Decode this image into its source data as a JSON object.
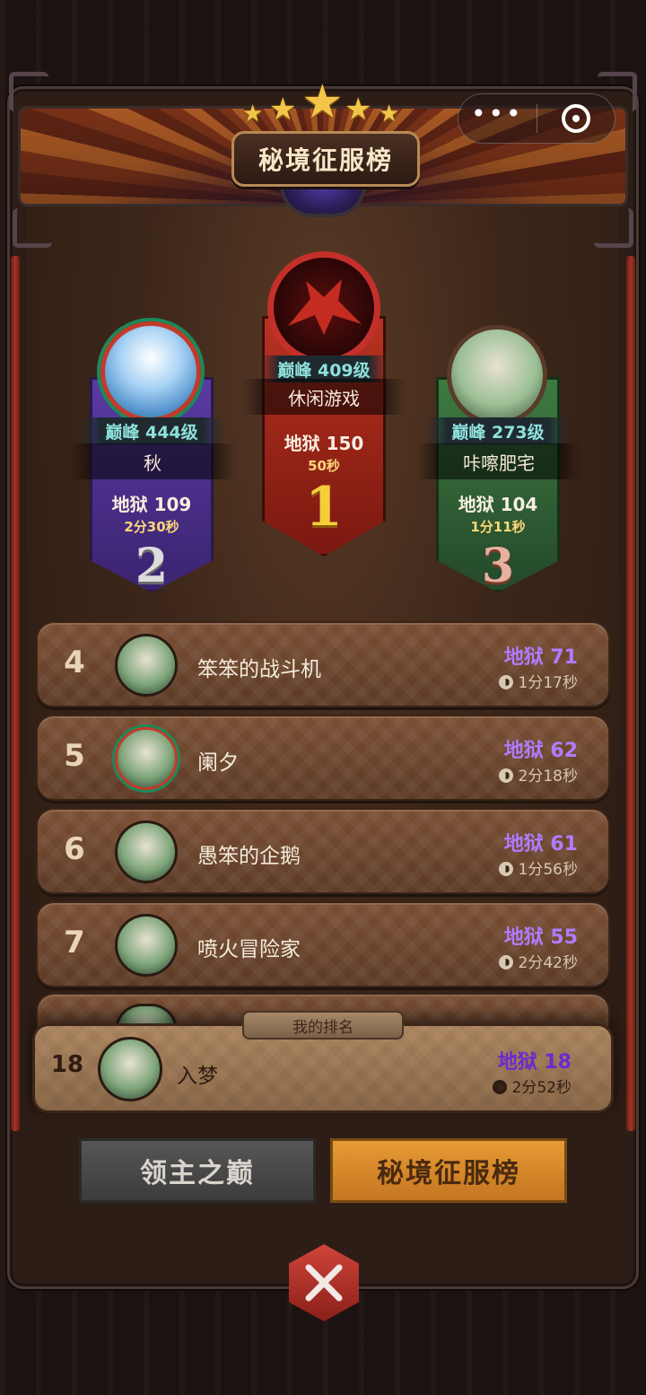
{
  "page": {
    "title": "秘境征服榜"
  },
  "capsule": {
    "more_icon": "ellipsis-icon",
    "close_icon": "target-icon"
  },
  "podium": [
    {
      "rank": "1",
      "level": "巅峰 409级",
      "name": "休闲游戏",
      "hell": "地狱 150",
      "time": "50秒",
      "color": "#a6261c"
    },
    {
      "rank": "2",
      "level": "巅峰 444级",
      "name": "秋",
      "hell": "地狱 109",
      "time": "2分30秒",
      "color": "#4a2f8c"
    },
    {
      "rank": "3",
      "level": "巅峰 273级",
      "name": "咔嚓肥宅",
      "hell": "地狱 104",
      "time": "1分11秒",
      "color": "#2f5a30"
    }
  ],
  "rows": [
    {
      "rank": "4",
      "name": "笨笨的战斗机",
      "hell": "地狱 71",
      "time": "1分17秒"
    },
    {
      "rank": "5",
      "name": "阑夕",
      "hell": "地狱 62",
      "time": "2分18秒"
    },
    {
      "rank": "6",
      "name": "愚笨的企鹅",
      "hell": "地狱 61",
      "time": "1分56秒"
    },
    {
      "rank": "7",
      "name": "喷火冒险家",
      "hell": "地狱 55",
      "time": "2分42秒"
    }
  ],
  "my_rank": {
    "label": "我的排名",
    "rank": "18",
    "name": "入梦",
    "hell": "地狱 18",
    "time": "2分52秒"
  },
  "tabs": {
    "left": "领主之巅",
    "right": "秘境征服榜"
  }
}
